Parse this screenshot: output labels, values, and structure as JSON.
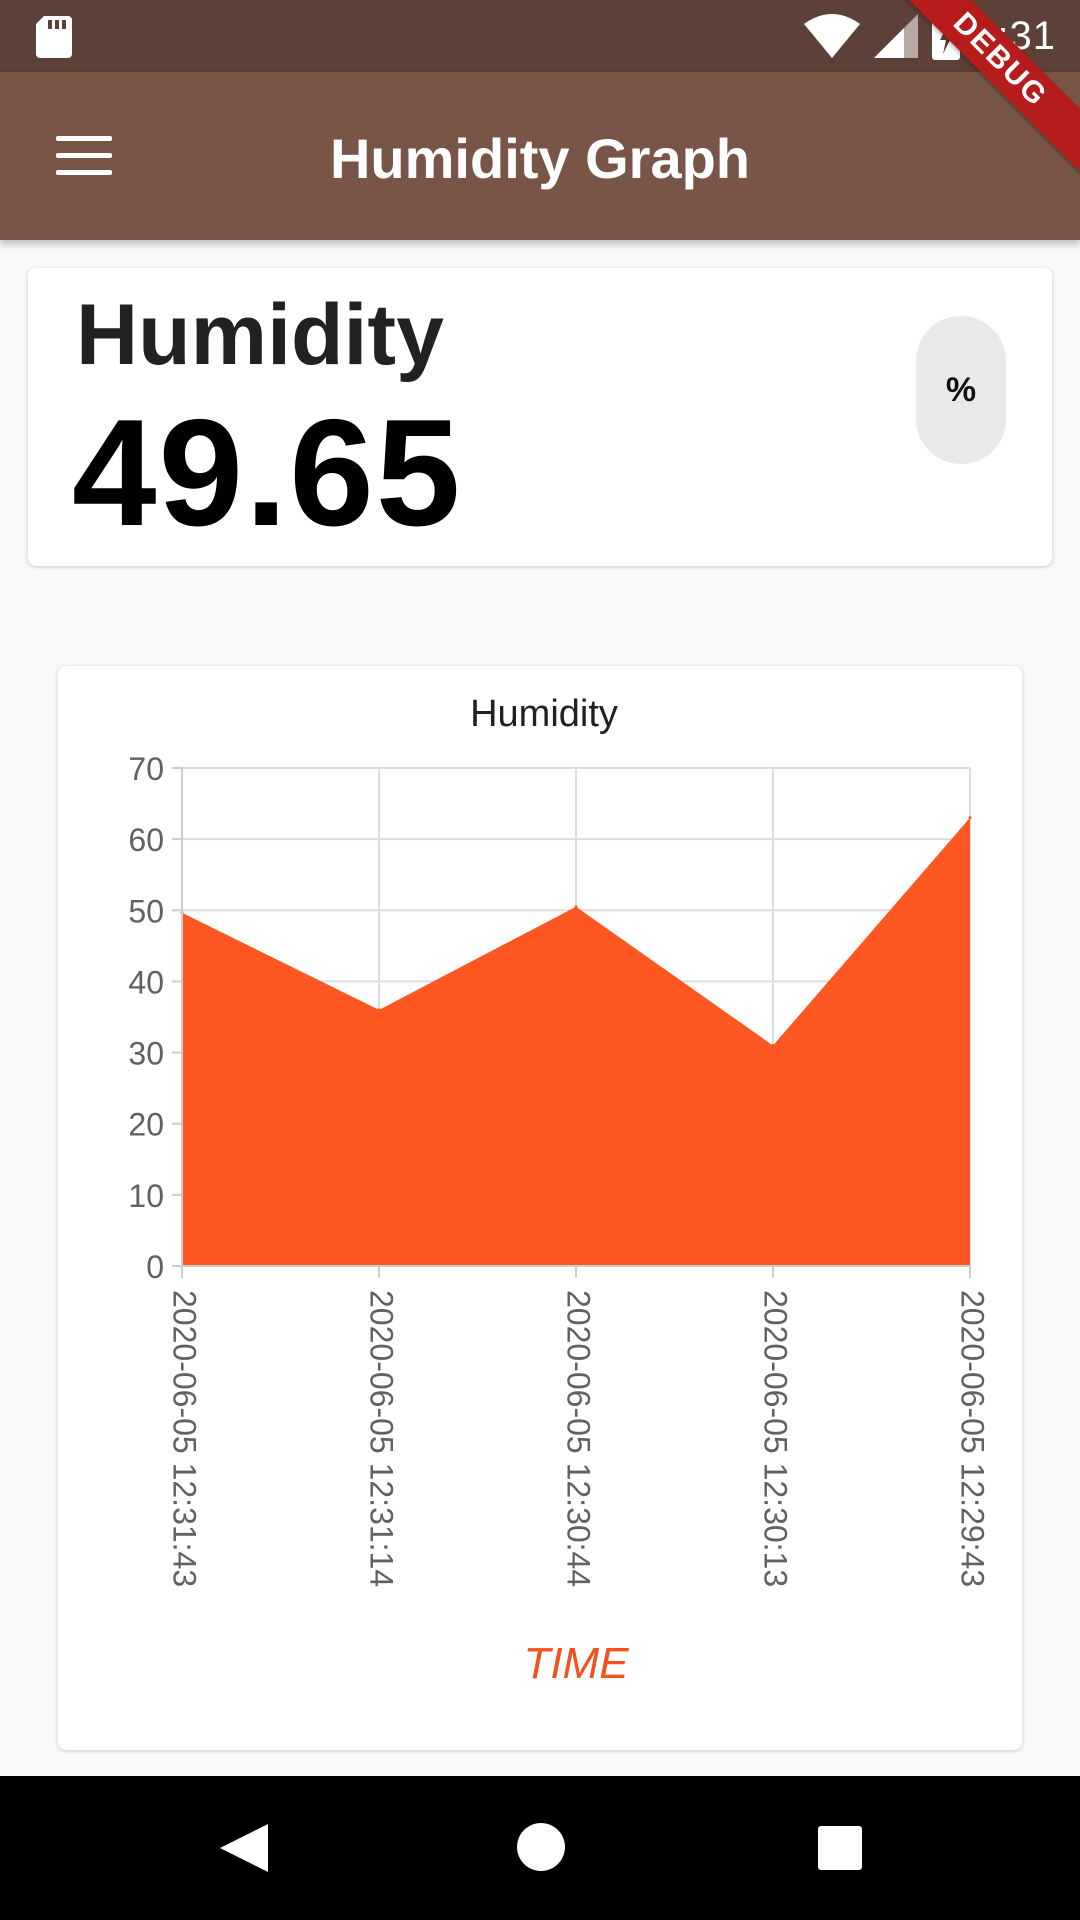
{
  "status_bar": {
    "time": "1:31",
    "icons": [
      "sd-card-icon",
      "wifi-icon",
      "cell-signal-icon",
      "battery-charging-icon"
    ]
  },
  "debug_banner": "DEBUG",
  "app_bar": {
    "title": "Humidity Graph",
    "menu_icon": "hamburger-menu-icon",
    "color": "#795548",
    "status_color": "#5d4037"
  },
  "reading": {
    "label": "Humidity",
    "value": "49.65",
    "unit": "%"
  },
  "chart_data": {
    "type": "area",
    "title": "Humidity",
    "xlabel": "TIME",
    "ylabel": "",
    "categories": [
      "2020-06-05 12:31:43",
      "2020-06-05 12:31:14",
      "2020-06-05 12:30:44",
      "2020-06-05 12:30:13",
      "2020-06-05 12:29:43"
    ],
    "series": [
      {
        "values": [
          49.65,
          36,
          50.5,
          31,
          63
        ]
      }
    ],
    "ylim": [
      0,
      70
    ],
    "yticks": [
      "0",
      "10",
      "20",
      "30",
      "40",
      "50",
      "60",
      "70"
    ],
    "grid": true,
    "fill_color": "#ff5722",
    "axis_label_color": "#f4511e"
  },
  "nav_bar": {
    "buttons": [
      "back-icon",
      "home-icon",
      "recents-icon"
    ]
  }
}
